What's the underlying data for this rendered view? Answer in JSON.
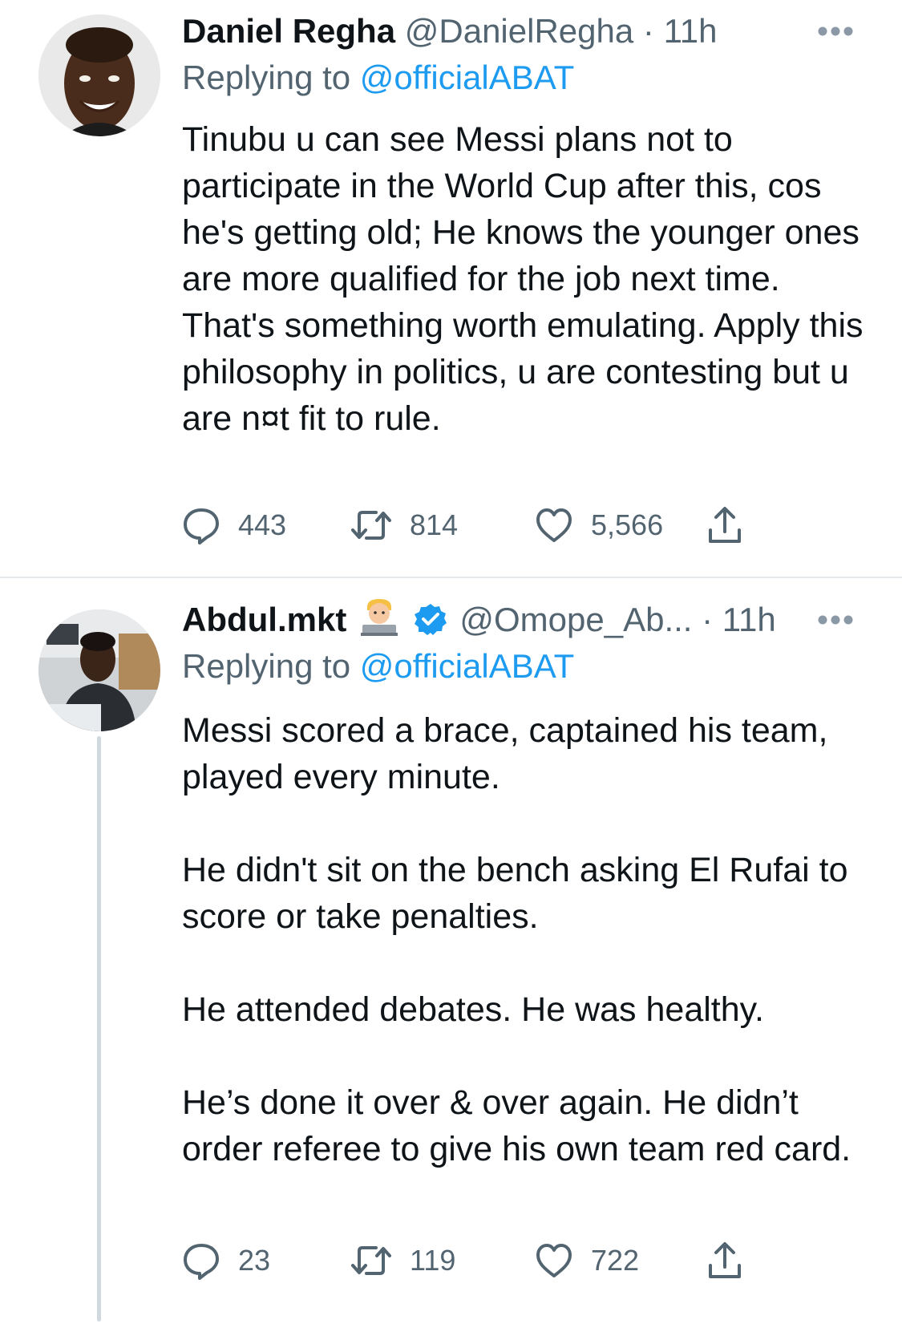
{
  "tweets": [
    {
      "display_name": "Daniel Regha",
      "handle": "@DanielRegha",
      "separator": "·",
      "time": "11h",
      "replying_label": "Replying to",
      "replying_handle": "@officialABAT",
      "paragraphs": [
        "Tinubu u can see Messi plans not to participate in the World Cup after this, cos he's getting old; He knows the younger ones are more qualified for the job next time. That's something worth emulating. Apply this philosophy in politics, u are contesting but u are n¤t fit to rule."
      ],
      "replies": "443",
      "retweets": "814",
      "likes": "5,566"
    },
    {
      "display_name": "Abdul.mkt",
      "display_emoji": "technologist-emoji",
      "verified": true,
      "handle": "@Omope_Ab...",
      "separator": "·",
      "time": "11h",
      "replying_label": "Replying to",
      "replying_handle": "@officialABAT",
      "paragraphs": [
        "Messi scored a brace, captained his team, played every minute.",
        "He didn't sit on the bench asking El Rufai to score or take penalties.",
        "He attended debates. He was healthy.",
        "He’s done it over & over again. He didn’t order referee to give his own team red card."
      ],
      "replies": "23",
      "retweets": "119",
      "likes": "722"
    }
  ],
  "colors": {
    "text": "#0f1419",
    "secondary": "#536471",
    "link": "#1d9bf0",
    "verified": "#1d9bf0",
    "divider": "#e6ebef",
    "thread_line": "#cfd9de"
  },
  "icons": {
    "reply": "speech-bubble-icon",
    "retweet": "retweet-arrows-icon",
    "like": "heart-outline-icon",
    "share": "share-upload-icon",
    "more": "ellipsis-icon"
  }
}
